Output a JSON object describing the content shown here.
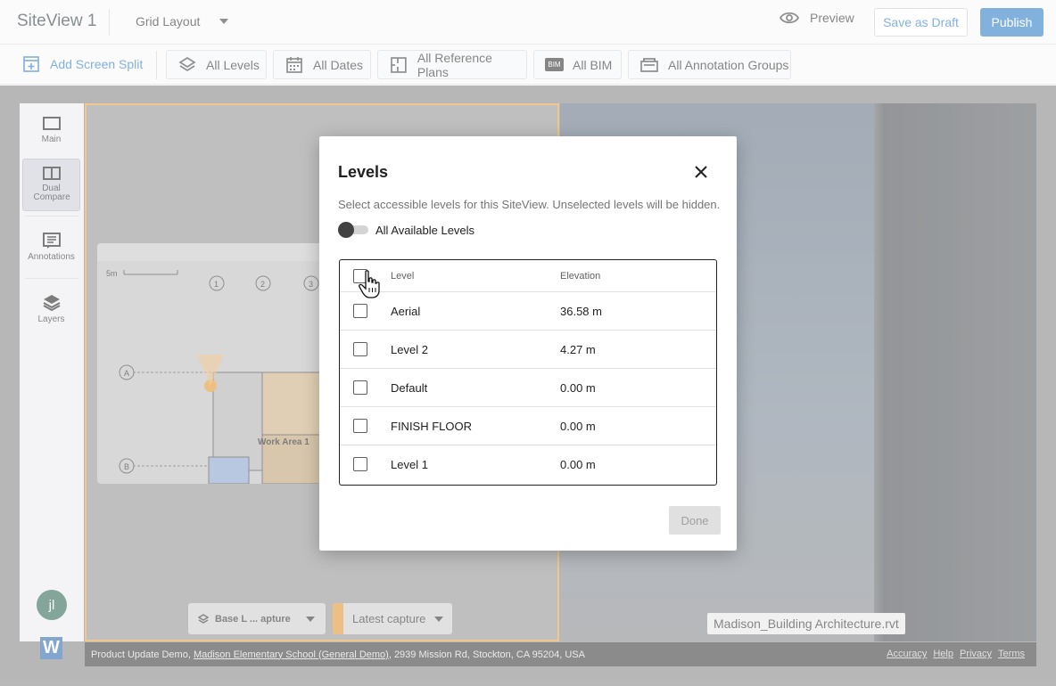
{
  "header": {
    "title": "SiteView 1",
    "layout_select": "Grid Layout",
    "preview_label": "Preview",
    "save_draft_label": "Save as Draft",
    "publish_label": "Publish"
  },
  "toolbar": {
    "add_split_label": "Add Screen Split",
    "filters": [
      {
        "label": "All Levels",
        "icon": "layers-icon"
      },
      {
        "label": "All Dates",
        "icon": "calendar-icon"
      },
      {
        "label": "All Reference Plans",
        "icon": "plan-icon"
      },
      {
        "label": "All BIM",
        "icon": "bim-icon"
      },
      {
        "label": "All Annotation Groups",
        "icon": "folder-icon"
      }
    ],
    "bim_badge": "BIM"
  },
  "sidebar": {
    "items": [
      {
        "label": "Main",
        "icon": "single-pane-icon"
      },
      {
        "label": "Dual Compare",
        "icon": "dual-pane-icon",
        "active": true
      },
      {
        "label": "Annotations",
        "icon": "annotations-icon"
      },
      {
        "label": "Layers",
        "icon": "layers-icon"
      }
    ],
    "avatar_initials": "jl",
    "logo_letter": "W"
  },
  "viewer": {
    "capture_left_label": "Base L ... apture",
    "capture_right_label": "Latest capture",
    "model_label": "Madison_Building Architecture.rvt",
    "minimap": {
      "scale_label": "5m",
      "work_area_label": "Work Area 1",
      "grid_labels": [
        "1",
        "2",
        "3",
        "A",
        "B"
      ]
    }
  },
  "footer": {
    "prefix": "Product Update Demo, ",
    "project_link": "Madison Elementary School (General Demo)",
    "address": ", 2939 Mission Rd, Stockton, CA 95204, USA",
    "links": [
      "Accuracy",
      "Help",
      "Privacy",
      "Terms"
    ]
  },
  "modal": {
    "title": "Levels",
    "description": "Select accessible levels for this SiteView. Unselected levels will be hidden.",
    "toggle_label": "All Available Levels",
    "table": {
      "headers": {
        "level": "Level",
        "elevation": "Elevation"
      },
      "rows": [
        {
          "level": "Aerial",
          "elevation": "36.58 m"
        },
        {
          "level": "Level 2",
          "elevation": "4.27 m"
        },
        {
          "level": "Default",
          "elevation": "0.00 m"
        },
        {
          "level": "FINISH FLOOR",
          "elevation": "0.00 m"
        },
        {
          "level": "Level 1",
          "elevation": "0.00 m"
        }
      ]
    },
    "done_label": "Done"
  },
  "colors": {
    "accent": "#1c72c4",
    "selection_border": "#e59a2c",
    "avatar_bg": "#1f5c45"
  }
}
